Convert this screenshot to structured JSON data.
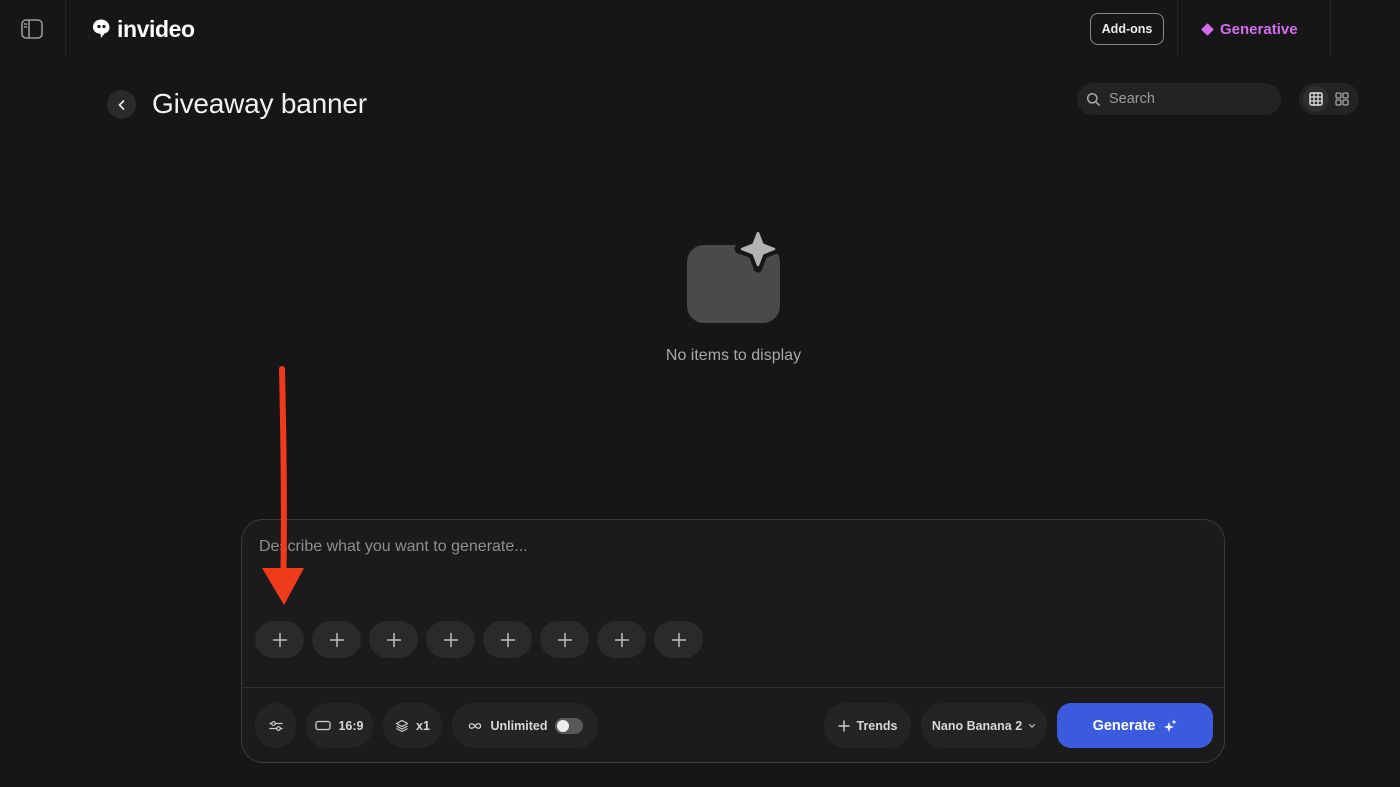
{
  "header": {
    "brand": "invideo",
    "addons_label": "Add-ons",
    "generative_label": "Generative"
  },
  "page": {
    "title": "Giveaway banner"
  },
  "search": {
    "placeholder": "Search"
  },
  "empty_state": {
    "text": "No items to display",
    "icon": "sparkle-image-icon"
  },
  "composer": {
    "placeholder": "Describe what you want to generate...",
    "slot_count": 8,
    "aspect_ratio": "16:9",
    "count": "x1",
    "unlimited_label": "Unlimited",
    "unlimited_enabled": false,
    "trends_label": "Trends",
    "model": "Nano Banana 2",
    "generate_label": "Generate"
  },
  "colors": {
    "background": "#161616",
    "accent_blue": "#3b5bdf",
    "generative_purple": "#d46bf0",
    "annotation_red": "#ef3a1c"
  }
}
